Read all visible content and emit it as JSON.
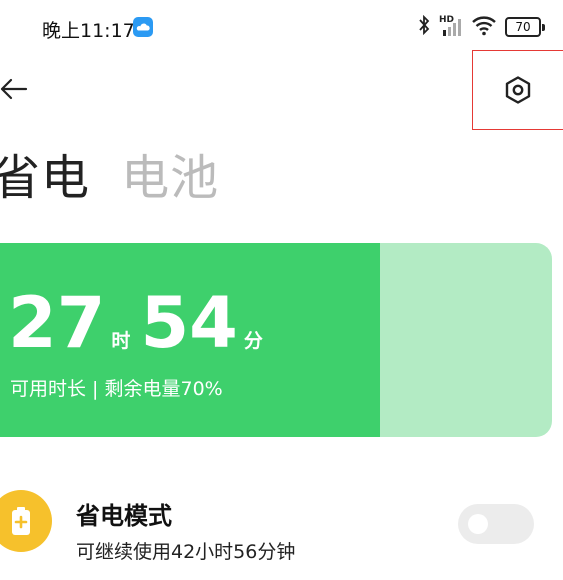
{
  "status_bar": {
    "time": "晚上11:17",
    "network_label": "HD",
    "battery_level": "70",
    "icons": [
      "cloud-icon",
      "bluetooth-icon",
      "signal-icon",
      "wifi-icon",
      "battery-icon"
    ]
  },
  "nav": {
    "back_icon": "arrow-left-icon",
    "settings_icon": "hexagon-settings-icon"
  },
  "tabs": [
    {
      "label": "省电",
      "active": true
    },
    {
      "label": "电池",
      "active": false
    }
  ],
  "battery_card": {
    "hours": "27",
    "hours_unit": "时",
    "minutes": "54",
    "minutes_unit": "分",
    "subtitle": "可用时长 | 剩余电量70%",
    "charge_fraction": 0.7,
    "fill_color": "#3ed06c",
    "track_color": "#b3ebc4"
  },
  "power_saver": {
    "icon": "battery-plus-icon",
    "icon_color": "#f6c12c",
    "title": "省电模式",
    "description": "可继续使用42小时56分钟",
    "enabled": false
  }
}
